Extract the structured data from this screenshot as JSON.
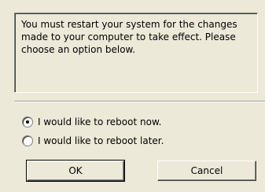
{
  "message": {
    "text": "You must restart your system for the changes made to your computer to take effect. Please choose an option below."
  },
  "options": [
    {
      "label": "I would like to reboot now.",
      "selected": true
    },
    {
      "label": "I would like to reboot later.",
      "selected": false
    }
  ],
  "buttons": {
    "ok_label": "OK",
    "cancel_label": "Cancel"
  }
}
